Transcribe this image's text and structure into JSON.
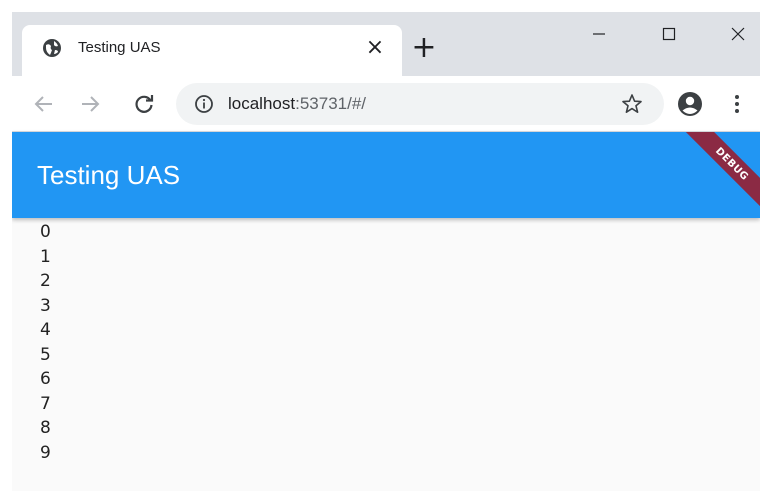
{
  "browser": {
    "tab": {
      "title": "Testing UAS",
      "favicon": "globe-icon",
      "close_label": "×"
    },
    "new_tab_label": "+",
    "window_controls": [
      "minimize-icon",
      "maximize-icon",
      "close-icon"
    ],
    "address": {
      "host": "localhost",
      "rest": ":53731/#/"
    },
    "toolbar_icons": [
      "back-arrow-icon",
      "forward-arrow-icon",
      "reload-icon",
      "info-icon",
      "star-icon",
      "profile-icon",
      "menu-icon"
    ]
  },
  "app": {
    "title": "Testing UAS",
    "debug_banner": "DEBUG",
    "items": [
      "0",
      "1",
      "2",
      "3",
      "4",
      "5",
      "6",
      "7",
      "8",
      "9"
    ]
  },
  "colors": {
    "appbar": "#2196f3",
    "debug_banner": "#8b2a44",
    "tabstrip": "#dee1e6",
    "page_background": "#fafafa"
  }
}
